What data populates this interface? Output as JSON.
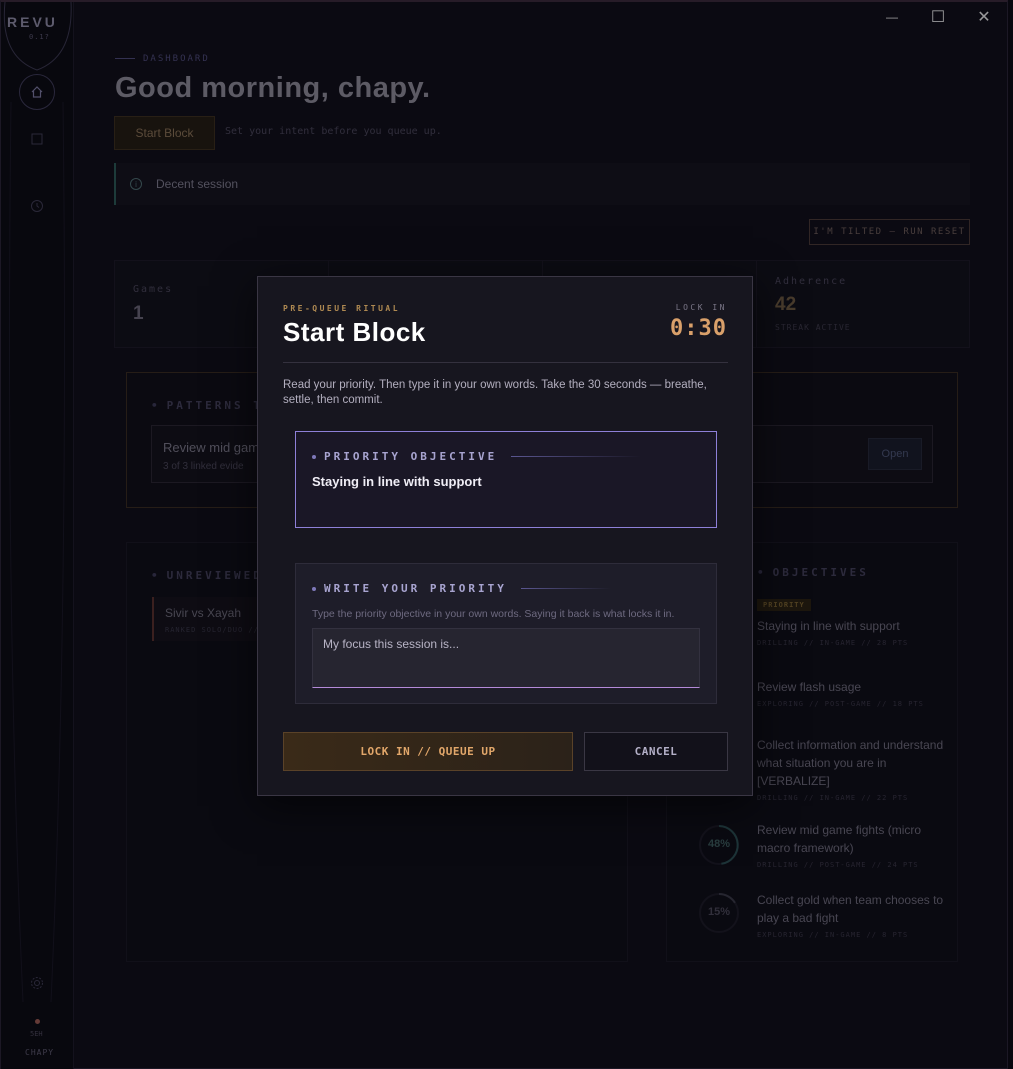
{
  "window": {
    "minimize_glyph": "—",
    "maximize_glyph": "☐",
    "close_glyph": "✕"
  },
  "sidebar": {
    "logo": "REVU",
    "version": "0.1?",
    "user_tag": "5EH",
    "user": "CHAPY",
    "icons": [
      "home-icon",
      "square-icon",
      "history-icon",
      "settings-icon"
    ]
  },
  "header": {
    "breadcrumb": "DASHBOARD",
    "greeting": "Good morning, chapy.",
    "start_block_label": "Start Block",
    "intent_hint": "Set your intent before you queue up."
  },
  "session_banner": {
    "text": "Decent session"
  },
  "tilted_button": "I'M TILTED — RUN RESET",
  "stats": {
    "games_label": "Games",
    "games_value": "1",
    "adherence_label": "Adherence",
    "adherence_value": "42",
    "adherence_sub": "STREAK ACTIVE"
  },
  "patterns": {
    "title": "PATTERNS TO",
    "card_name": "Review mid gam",
    "card_sub": "3 of 3 linked evide",
    "open_label": "Open"
  },
  "unreviewed": {
    "title": "UNREVIEWED",
    "item_name": "Sivir vs Xayah",
    "item_sub": "RANKED SOLO/DUO  //"
  },
  "objectives": {
    "title": "OBJECTIVES",
    "priority_badge": "PRIORITY",
    "items": [
      {
        "name": "Staying in line with support",
        "meta": "DRILLING  //  IN-GAME  //  28 PTS"
      },
      {
        "name": "Review flash usage",
        "meta": "EXPLORING  //  POST-GAME  //  18 PTS"
      },
      {
        "name": "Collect information and understand what situation you are in [VERBALIZE]",
        "meta": "DRILLING  //  IN-GAME  //  22 PTS"
      },
      {
        "name": "Review mid game fights (micro macro framework)",
        "meta": "DRILLING  //  POST-GAME  //  24 PTS",
        "progress": "48%"
      },
      {
        "name": "Collect gold when team chooses to play a bad fight",
        "meta": "EXPLORING  //  IN-GAME  //  8 PTS",
        "progress": "15%"
      }
    ]
  },
  "modal": {
    "kicker": "PRE-QUEUE RITUAL",
    "title": "Start Block",
    "lock_label": "LOCK IN",
    "lock_value": "0:30",
    "description": "Read your priority. Then type it in your own words. Take the 30 seconds — breathe, settle, then commit.",
    "priority_label": "PRIORITY OBJECTIVE",
    "priority_text": "Staying in line with support",
    "write_label": "WRITE YOUR PRIORITY",
    "write_hint": "Type the priority objective in your own words. Saying it back is what locks it in.",
    "write_placeholder": "My focus this session is...",
    "lock_button": "LOCK IN // QUEUE UP",
    "cancel_button": "CANCEL"
  }
}
